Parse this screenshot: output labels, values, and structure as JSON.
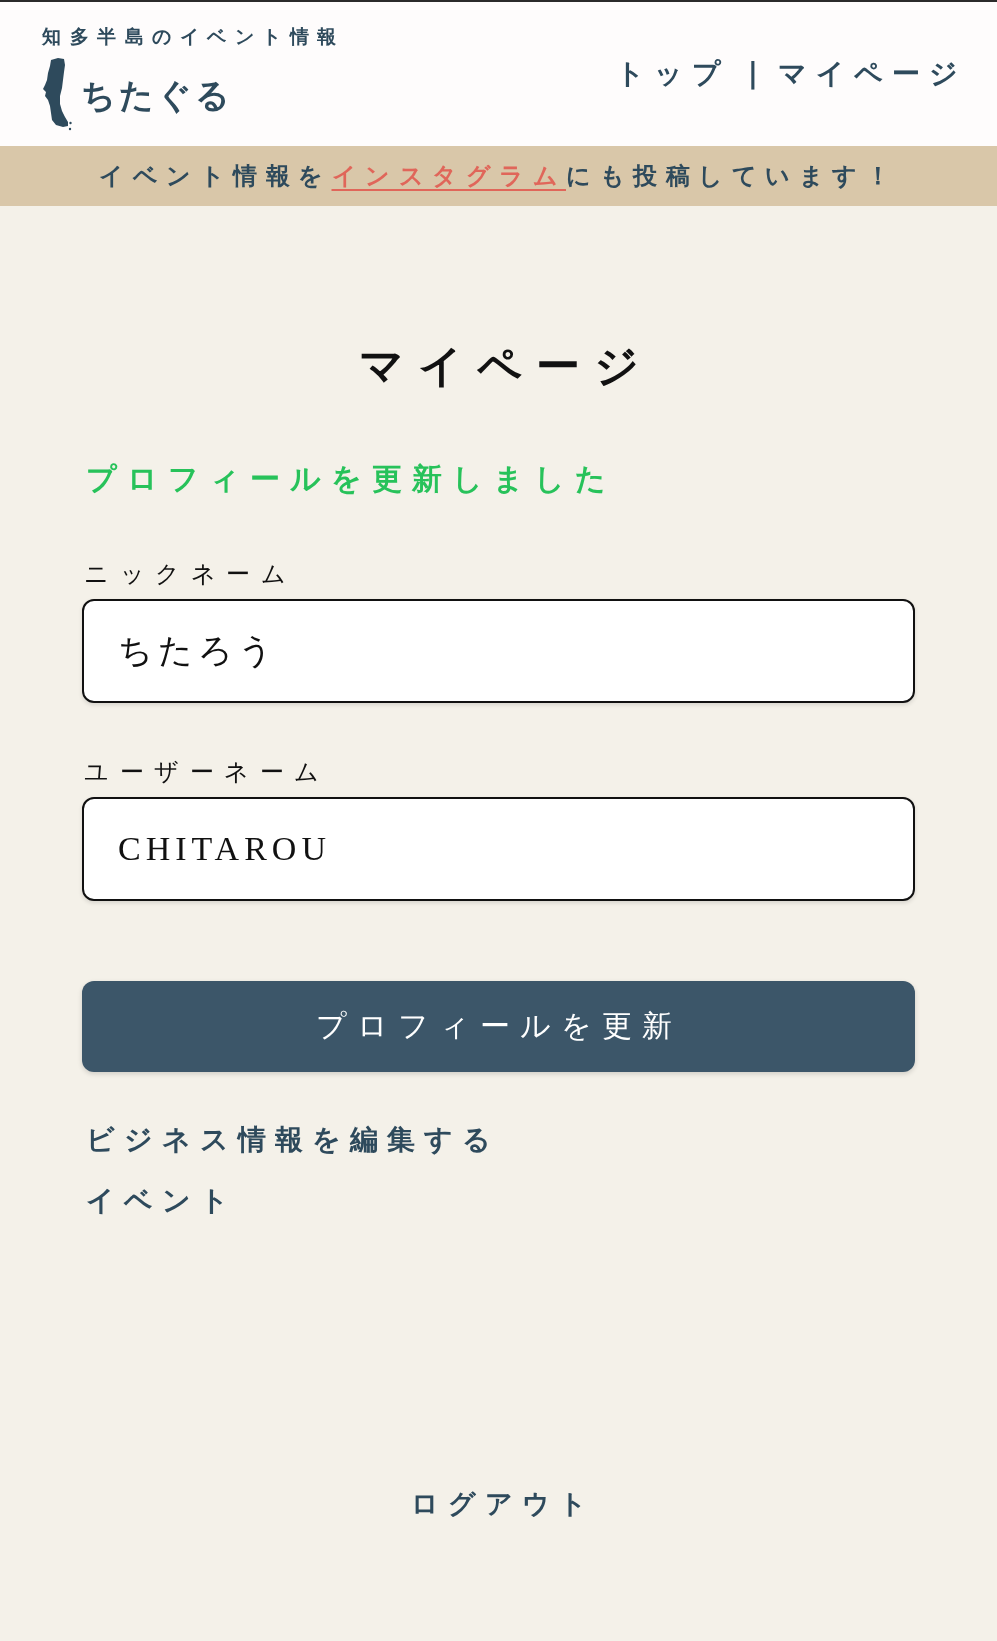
{
  "header": {
    "tagline": "知多半島のイベント情報",
    "logo_text": "ちたぐる",
    "nav": [
      {
        "label": "トップ"
      },
      {
        "label": "マイページ"
      }
    ],
    "nav_separator": "|"
  },
  "banner": {
    "text_before": "イベント情報を",
    "link": "インスタグラム",
    "text_after": "にも投稿しています！"
  },
  "page": {
    "title": "マイページ",
    "notice": {
      "kind": "success",
      "text": "プロフィールを更新しました"
    },
    "fields": [
      {
        "label": "ニックネーム",
        "value": "ちたろう"
      },
      {
        "label": "ユーザーネーム",
        "value": "CHITAROU"
      }
    ],
    "submit_button": "プロフィールを更新",
    "links": [
      {
        "label": "ビジネス情報を編集する"
      },
      {
        "label": "イベント"
      }
    ],
    "logout": "ログアウト"
  }
}
